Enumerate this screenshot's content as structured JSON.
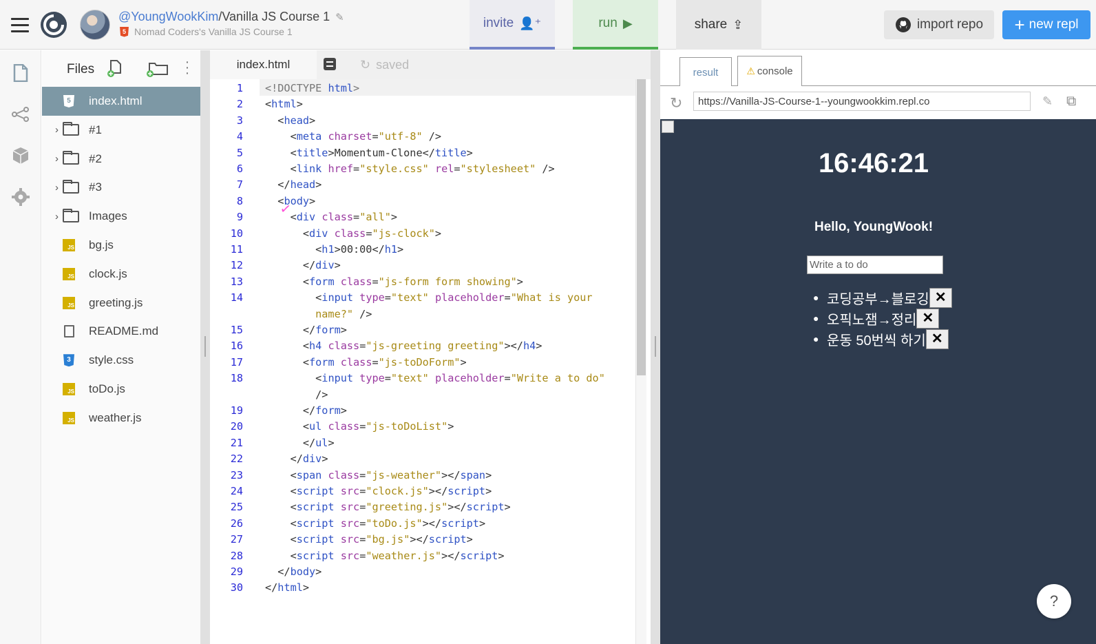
{
  "topbar": {
    "owner": "@YoungWookKim",
    "separator": "/",
    "repl_name": "Vanilla JS Course 1",
    "subtitle": "Nomad Coders's Vanilla JS Course 1",
    "invite_label": "invite",
    "run_label": "run",
    "share_label": "share",
    "import_label": "import repo",
    "new_label": "new repl"
  },
  "files": {
    "title": "Files",
    "items": [
      {
        "label": "index.html",
        "type": "html",
        "active": true
      },
      {
        "label": "#1",
        "type": "folder"
      },
      {
        "label": "#2",
        "type": "folder"
      },
      {
        "label": "#3",
        "type": "folder"
      },
      {
        "label": "Images",
        "type": "folder"
      },
      {
        "label": "bg.js",
        "type": "js"
      },
      {
        "label": "clock.js",
        "type": "js"
      },
      {
        "label": "greeting.js",
        "type": "js"
      },
      {
        "label": "README.md",
        "type": "doc"
      },
      {
        "label": "style.css",
        "type": "css"
      },
      {
        "label": "toDo.js",
        "type": "js"
      },
      {
        "label": "weather.js",
        "type": "js"
      }
    ]
  },
  "editor": {
    "tab_label": "index.html",
    "saved_label": "saved",
    "lines": [
      {
        "n": "1",
        "t": [
          [
            "g",
            "<!DOCTYPE "
          ],
          [
            "k",
            "html"
          ],
          [
            "g",
            ">"
          ]
        ]
      },
      {
        "n": "2",
        "t": [
          [
            "p",
            "<"
          ],
          [
            "k",
            "html"
          ],
          [
            "p",
            ">"
          ]
        ]
      },
      {
        "n": "3",
        "t": [
          [
            "p",
            "  <"
          ],
          [
            "k",
            "head"
          ],
          [
            "p",
            ">"
          ]
        ]
      },
      {
        "n": "4",
        "t": [
          [
            "p",
            "    <"
          ],
          [
            "k",
            "meta"
          ],
          [
            "p",
            " "
          ],
          [
            "a",
            "charset"
          ],
          [
            "p",
            "="
          ],
          [
            "s",
            "\"utf-8\""
          ],
          [
            "p",
            " />"
          ]
        ]
      },
      {
        "n": "5",
        "t": [
          [
            "p",
            "    <"
          ],
          [
            "k",
            "title"
          ],
          [
            "p",
            ">Momentum-Clone</"
          ],
          [
            "k",
            "title"
          ],
          [
            "p",
            ">"
          ]
        ]
      },
      {
        "n": "6",
        "t": [
          [
            "p",
            "    <"
          ],
          [
            "k",
            "link"
          ],
          [
            "p",
            " "
          ],
          [
            "a",
            "href"
          ],
          [
            "p",
            "="
          ],
          [
            "s",
            "\"style.css\""
          ],
          [
            "p",
            " "
          ],
          [
            "a",
            "rel"
          ],
          [
            "p",
            "="
          ],
          [
            "s",
            "\"stylesheet\""
          ],
          [
            "p",
            " />"
          ]
        ]
      },
      {
        "n": "7",
        "t": [
          [
            "p",
            "  </"
          ],
          [
            "k",
            "head"
          ],
          [
            "p",
            ">"
          ]
        ]
      },
      {
        "n": "8",
        "t": [
          [
            "p",
            "  <"
          ],
          [
            "k",
            "body"
          ],
          [
            "p",
            ">"
          ]
        ]
      },
      {
        "n": "9",
        "t": [
          [
            "p",
            "    <"
          ],
          [
            "k",
            "div"
          ],
          [
            "p",
            " "
          ],
          [
            "a",
            "class"
          ],
          [
            "p",
            "="
          ],
          [
            "s",
            "\"all\""
          ],
          [
            "p",
            ">"
          ]
        ]
      },
      {
        "n": "10",
        "t": [
          [
            "p",
            "      <"
          ],
          [
            "k",
            "div"
          ],
          [
            "p",
            " "
          ],
          [
            "a",
            "class"
          ],
          [
            "p",
            "="
          ],
          [
            "s",
            "\"js-clock\""
          ],
          [
            "p",
            ">"
          ]
        ]
      },
      {
        "n": "11",
        "t": [
          [
            "p",
            "        <"
          ],
          [
            "k",
            "h1"
          ],
          [
            "p",
            ">00:00</"
          ],
          [
            "k",
            "h1"
          ],
          [
            "p",
            ">"
          ]
        ]
      },
      {
        "n": "12",
        "t": [
          [
            "p",
            "      </"
          ],
          [
            "k",
            "div"
          ],
          [
            "p",
            ">"
          ]
        ]
      },
      {
        "n": "13",
        "t": [
          [
            "p",
            "      <"
          ],
          [
            "k",
            "form"
          ],
          [
            "p",
            " "
          ],
          [
            "a",
            "class"
          ],
          [
            "p",
            "="
          ],
          [
            "s",
            "\"js-form form showing\""
          ],
          [
            "p",
            ">"
          ]
        ]
      },
      {
        "n": "14",
        "t": [
          [
            "p",
            "        <"
          ],
          [
            "k",
            "input"
          ],
          [
            "p",
            " "
          ],
          [
            "a",
            "type"
          ],
          [
            "p",
            "="
          ],
          [
            "s",
            "\"text\""
          ],
          [
            "p",
            " "
          ],
          [
            "a",
            "placeholder"
          ],
          [
            "p",
            "="
          ],
          [
            "s",
            "\"What is your"
          ]
        ]
      },
      {
        "n": "",
        "t": [
          [
            "s",
            "        name?\""
          ],
          [
            "p",
            " />"
          ]
        ]
      },
      {
        "n": "15",
        "t": [
          [
            "p",
            "      </"
          ],
          [
            "k",
            "form"
          ],
          [
            "p",
            ">"
          ]
        ]
      },
      {
        "n": "16",
        "t": [
          [
            "p",
            "      <"
          ],
          [
            "k",
            "h4"
          ],
          [
            "p",
            " "
          ],
          [
            "a",
            "class"
          ],
          [
            "p",
            "="
          ],
          [
            "s",
            "\"js-greeting greeting\""
          ],
          [
            "p",
            "></"
          ],
          [
            "k",
            "h4"
          ],
          [
            "p",
            ">"
          ]
        ]
      },
      {
        "n": "17",
        "t": [
          [
            "p",
            "      <"
          ],
          [
            "k",
            "form"
          ],
          [
            "p",
            " "
          ],
          [
            "a",
            "class"
          ],
          [
            "p",
            "="
          ],
          [
            "s",
            "\"js-toDoForm\""
          ],
          [
            "p",
            ">"
          ]
        ]
      },
      {
        "n": "18",
        "t": [
          [
            "p",
            "        <"
          ],
          [
            "k",
            "input"
          ],
          [
            "p",
            " "
          ],
          [
            "a",
            "type"
          ],
          [
            "p",
            "="
          ],
          [
            "s",
            "\"text\""
          ],
          [
            "p",
            " "
          ],
          [
            "a",
            "placeholder"
          ],
          [
            "p",
            "="
          ],
          [
            "s",
            "\"Write a to do\""
          ]
        ]
      },
      {
        "n": "",
        "t": [
          [
            "p",
            "        />"
          ]
        ]
      },
      {
        "n": "19",
        "t": [
          [
            "p",
            "      </"
          ],
          [
            "k",
            "form"
          ],
          [
            "p",
            ">"
          ]
        ]
      },
      {
        "n": "20",
        "t": [
          [
            "p",
            "      <"
          ],
          [
            "k",
            "ul"
          ],
          [
            "p",
            " "
          ],
          [
            "a",
            "class"
          ],
          [
            "p",
            "="
          ],
          [
            "s",
            "\"js-toDoList\""
          ],
          [
            "p",
            ">"
          ]
        ]
      },
      {
        "n": "21",
        "t": [
          [
            "p",
            "      </"
          ],
          [
            "k",
            "ul"
          ],
          [
            "p",
            ">"
          ]
        ]
      },
      {
        "n": "22",
        "t": [
          [
            "p",
            "    </"
          ],
          [
            "k",
            "div"
          ],
          [
            "p",
            ">"
          ]
        ]
      },
      {
        "n": "23",
        "t": [
          [
            "p",
            "    <"
          ],
          [
            "k",
            "span"
          ],
          [
            "p",
            " "
          ],
          [
            "a",
            "class"
          ],
          [
            "p",
            "="
          ],
          [
            "s",
            "\"js-weather\""
          ],
          [
            "p",
            "></"
          ],
          [
            "k",
            "span"
          ],
          [
            "p",
            ">"
          ]
        ]
      },
      {
        "n": "24",
        "t": [
          [
            "p",
            "    <"
          ],
          [
            "k",
            "script"
          ],
          [
            "p",
            " "
          ],
          [
            "a",
            "src"
          ],
          [
            "p",
            "="
          ],
          [
            "s",
            "\"clock.js\""
          ],
          [
            "p",
            "></"
          ],
          [
            "k",
            "script"
          ],
          [
            "p",
            ">"
          ]
        ]
      },
      {
        "n": "25",
        "t": [
          [
            "p",
            "    <"
          ],
          [
            "k",
            "script"
          ],
          [
            "p",
            " "
          ],
          [
            "a",
            "src"
          ],
          [
            "p",
            "="
          ],
          [
            "s",
            "\"greeting.js\""
          ],
          [
            "p",
            "></"
          ],
          [
            "k",
            "script"
          ],
          [
            "p",
            ">"
          ]
        ]
      },
      {
        "n": "26",
        "t": [
          [
            "p",
            "    <"
          ],
          [
            "k",
            "script"
          ],
          [
            "p",
            " "
          ],
          [
            "a",
            "src"
          ],
          [
            "p",
            "="
          ],
          [
            "s",
            "\"toDo.js\""
          ],
          [
            "p",
            "></"
          ],
          [
            "k",
            "script"
          ],
          [
            "p",
            ">"
          ]
        ]
      },
      {
        "n": "27",
        "t": [
          [
            "p",
            "    <"
          ],
          [
            "k",
            "script"
          ],
          [
            "p",
            " "
          ],
          [
            "a",
            "src"
          ],
          [
            "p",
            "="
          ],
          [
            "s",
            "\"bg.js\""
          ],
          [
            "p",
            "></"
          ],
          [
            "k",
            "script"
          ],
          [
            "p",
            ">"
          ]
        ]
      },
      {
        "n": "28",
        "t": [
          [
            "p",
            "    <"
          ],
          [
            "k",
            "script"
          ],
          [
            "p",
            " "
          ],
          [
            "a",
            "src"
          ],
          [
            "p",
            "="
          ],
          [
            "s",
            "\"weather.js\""
          ],
          [
            "p",
            "></"
          ],
          [
            "k",
            "script"
          ],
          [
            "p",
            ">"
          ]
        ]
      },
      {
        "n": "29",
        "t": [
          [
            "p",
            "  </"
          ],
          [
            "k",
            "body"
          ],
          [
            "p",
            ">"
          ]
        ]
      },
      {
        "n": "30",
        "t": [
          [
            "p",
            "</"
          ],
          [
            "k",
            "html"
          ],
          [
            "p",
            ">"
          ]
        ]
      }
    ]
  },
  "output": {
    "result_tab": "result",
    "console_tab": "console",
    "url": "https://Vanilla-JS-Course-1--youngwookkim.repl.co",
    "clock": "16:46:21",
    "greeting": "Hello, YoungWook!",
    "todo_placeholder": "Write a to do",
    "todos": [
      "코딩공부→블로깅",
      "오픽노잼→정리",
      "운동 50번씩 하기"
    ],
    "delete_label": "✕",
    "help_label": "?"
  },
  "colors": {
    "accent_blue": "#3d97f0",
    "run_green": "#4caf50",
    "invite_purple": "#7584c8",
    "active_file": "#7d98a5",
    "preview_bg": "#2e3b4e"
  }
}
